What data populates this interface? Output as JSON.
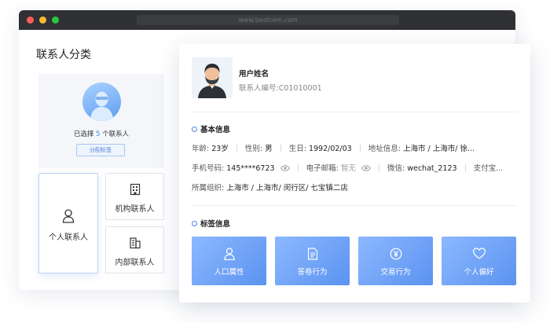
{
  "browser": {
    "url": "www.bestcem.com"
  },
  "page": {
    "title": "联系人分类"
  },
  "selection": {
    "prefix": "已选择",
    "count": "5",
    "suffix": "个联系人",
    "assign_label": "分配标签"
  },
  "categories": {
    "personal": "个人联系人",
    "org": "机构联系人",
    "internal": "内部联系人"
  },
  "profile": {
    "name": "用户姓名",
    "id_label": "联系人编号:C01010001"
  },
  "basic": {
    "title": "基本信息",
    "age_label": "年龄:",
    "age": "23岁",
    "gender_label": "性别:",
    "gender": "男",
    "birthday_label": "生日:",
    "birthday": "1992/02/03",
    "address_label": "地址信息:",
    "address": "上海市 / 上海市/ 徐...",
    "phone_label": "手机号码:",
    "phone": "145****6723",
    "email_label": "电子邮箱:",
    "email": "暂无",
    "wechat_label": "微信:",
    "wechat": "wechat_2123",
    "pay_label": "支付宝...",
    "org_label": "所属组织:",
    "org": "上海市 / 上海市/ 闵行区/ 七宝镇二店"
  },
  "tags": {
    "title": "标签信息",
    "items": [
      {
        "label": "人口属性",
        "icon": "person-icon"
      },
      {
        "label": "答卷行为",
        "icon": "document-icon"
      },
      {
        "label": "交易行为",
        "icon": "yen-coin-icon"
      },
      {
        "label": "个人偏好",
        "icon": "heart-icon"
      }
    ]
  }
}
